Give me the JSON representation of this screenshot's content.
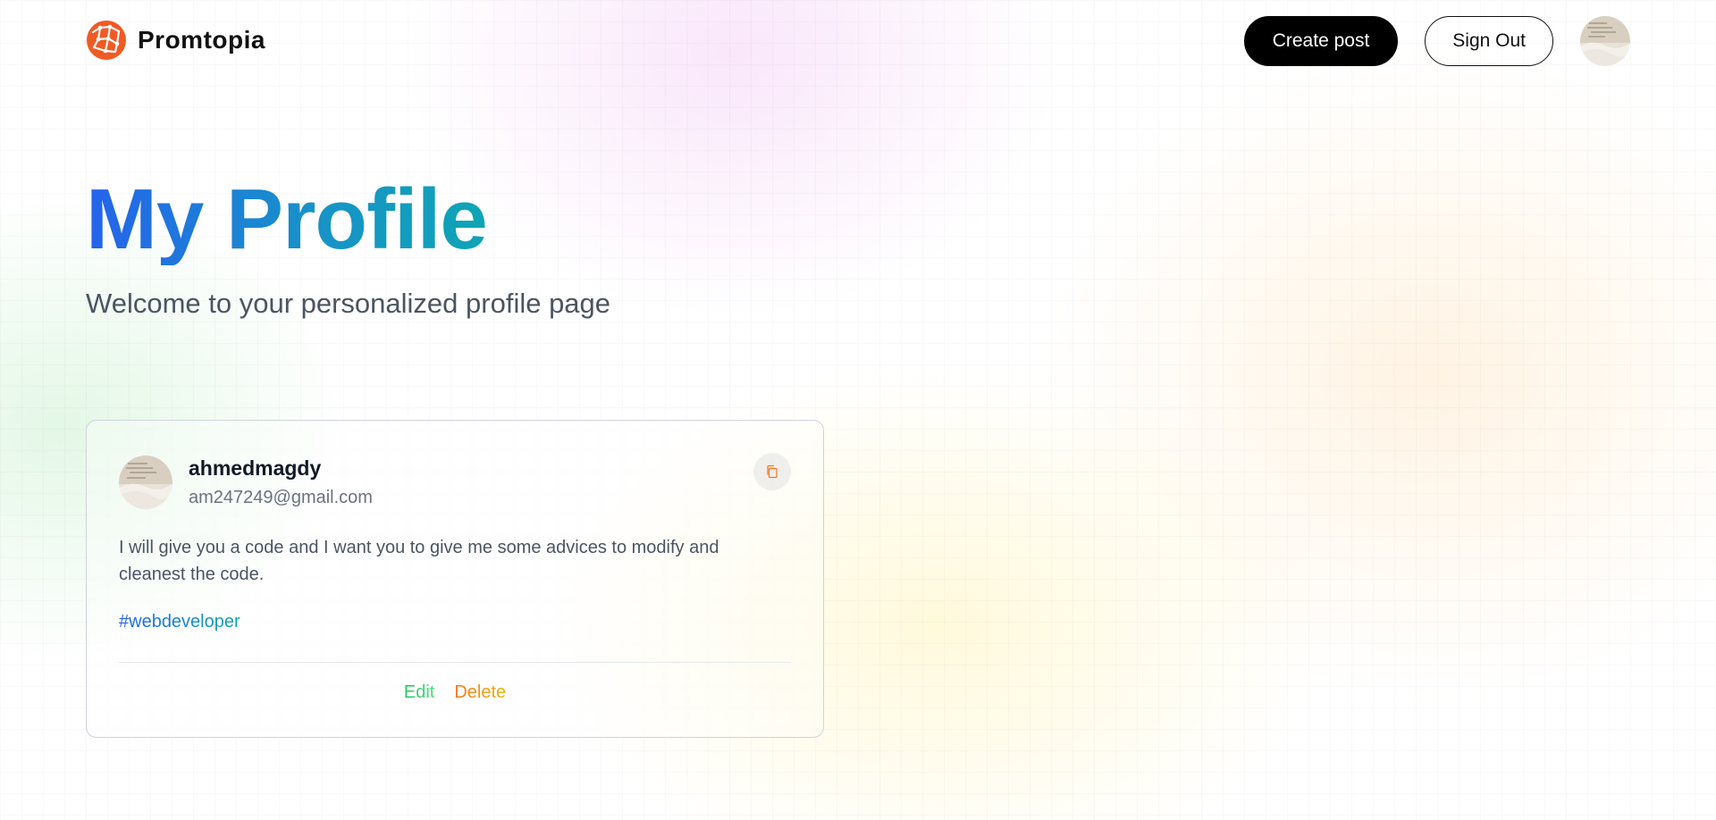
{
  "brand": {
    "name": "Promtopia",
    "logo_icon": "globe-network-icon",
    "logo_color": "#f15a24"
  },
  "nav": {
    "create_post_label": "Create post",
    "sign_out_label": "Sign Out",
    "avatar_icon": "user-avatar-image"
  },
  "hero": {
    "title": "My Profile",
    "subtitle": "Welcome to your personalized profile page",
    "title_gradient": [
      "#2563eb",
      "#0ea5b5"
    ]
  },
  "posts": [
    {
      "username": "ahmedmagdy",
      "email": "am247249@gmail.com",
      "prompt": "I will give you a code and I want you to give me some advices to modify and cleanest the code.",
      "tag": "#webdeveloper",
      "copy_icon": "copy-icon",
      "edit_label": "Edit",
      "delete_label": "Delete"
    }
  ],
  "colors": {
    "primary_button": "#000000",
    "text_dark": "#111827",
    "text_muted": "#4b5563",
    "edit_green": "#22c55e",
    "delete_orange": "#f97316"
  }
}
